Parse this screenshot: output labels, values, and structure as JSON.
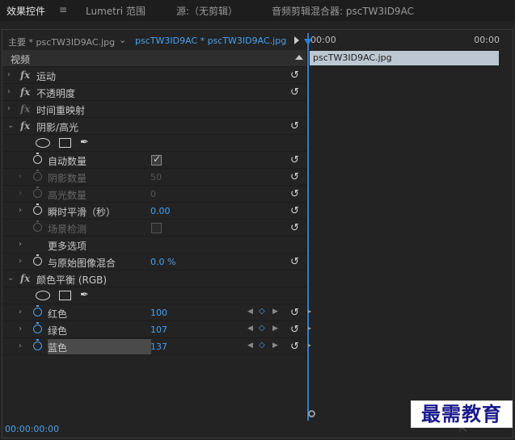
{
  "tabs": [
    {
      "label": "效果控件",
      "active": true
    },
    {
      "label": "Lumetri 范围",
      "active": false
    },
    {
      "label": "源:（无剪辑）",
      "active": false
    },
    {
      "label": "音频剪辑混合器: pscTW3ID9AC",
      "active": false
    }
  ],
  "tab_menu_icon": "≡",
  "source": {
    "main": "主要 * pscTW3ID9AC.jpg",
    "clip": "pscTW3ID9AC * pscTW3ID9AC.jpg"
  },
  "section_title": "视频",
  "effects": {
    "motion": "运动",
    "opacity": "不透明度",
    "time_remap": "时间重映射",
    "shadow_highlight": {
      "title": "阴影/高光",
      "auto_amount": {
        "label": "自动数量",
        "checked": true
      },
      "shadow_amount": {
        "label": "阴影数量",
        "value": "50"
      },
      "highlight_amount": {
        "label": "高光数量",
        "value": "0"
      },
      "temporal_smoothing": {
        "label": "瞬时平滑（秒）",
        "value": "0.00"
      },
      "scene_detect": {
        "label": "场景检测",
        "checked": false
      },
      "more_options": "更多选项",
      "blend_original": {
        "label": "与原始图像混合",
        "value": "0.0 %"
      }
    },
    "color_balance": {
      "title": "颜色平衡 (RGB)",
      "red": {
        "label": "红色",
        "value": "100"
      },
      "green": {
        "label": "绿色",
        "value": "107"
      },
      "blue": {
        "label": "蓝色",
        "value": "137"
      }
    }
  },
  "timeline": {
    "start": "00:00",
    "end": "00:00",
    "clip_name": "pscTW3ID9AC.jpg"
  },
  "timecode": "00:00:00:00",
  "watermark": "最需教育",
  "colors": {
    "accent": "#4aa0ea",
    "clip": "#bcc7d1",
    "playhead": "#2f7fd0"
  }
}
